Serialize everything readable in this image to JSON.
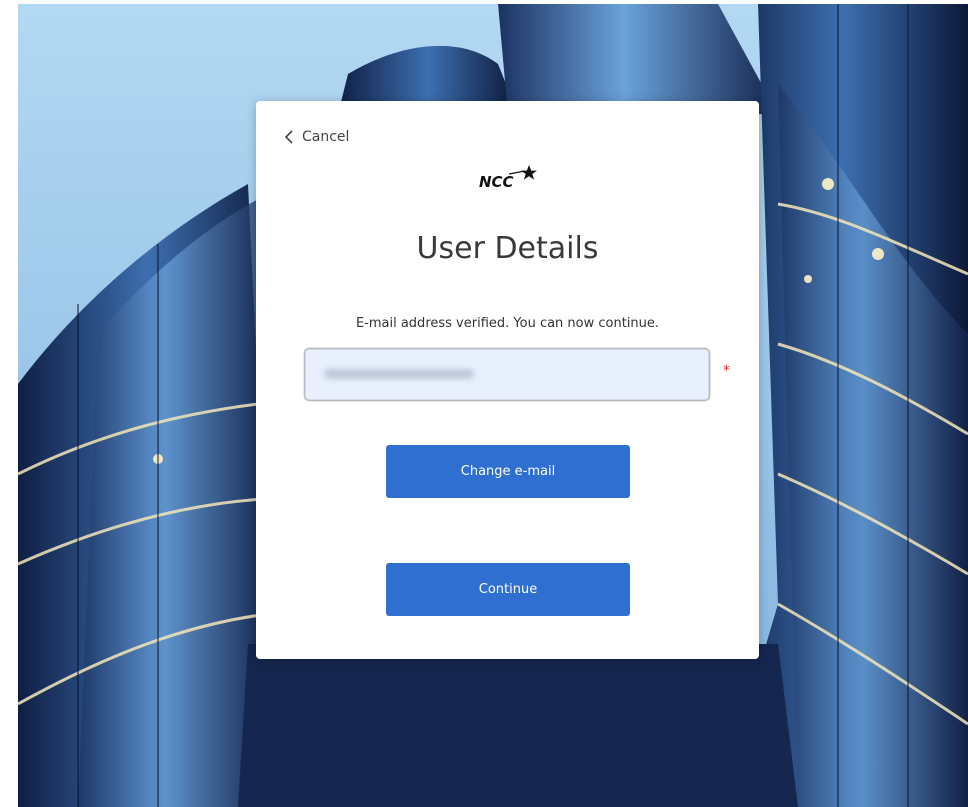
{
  "nav": {
    "cancel_label": "Cancel"
  },
  "brand": {
    "logo_text": "NCC",
    "logo_icon": "star-icon"
  },
  "form": {
    "title": "User Details",
    "status_message": "E-mail address verified. You can now continue.",
    "email": {
      "value": "",
      "required_marker": "*"
    },
    "change_email_label": "Change e-mail",
    "continue_label": "Continue"
  },
  "colors": {
    "primary_button": "#2f6fcf",
    "input_background": "#e8f0fe",
    "required": "#e3342f",
    "title": "#3a3a3a"
  }
}
